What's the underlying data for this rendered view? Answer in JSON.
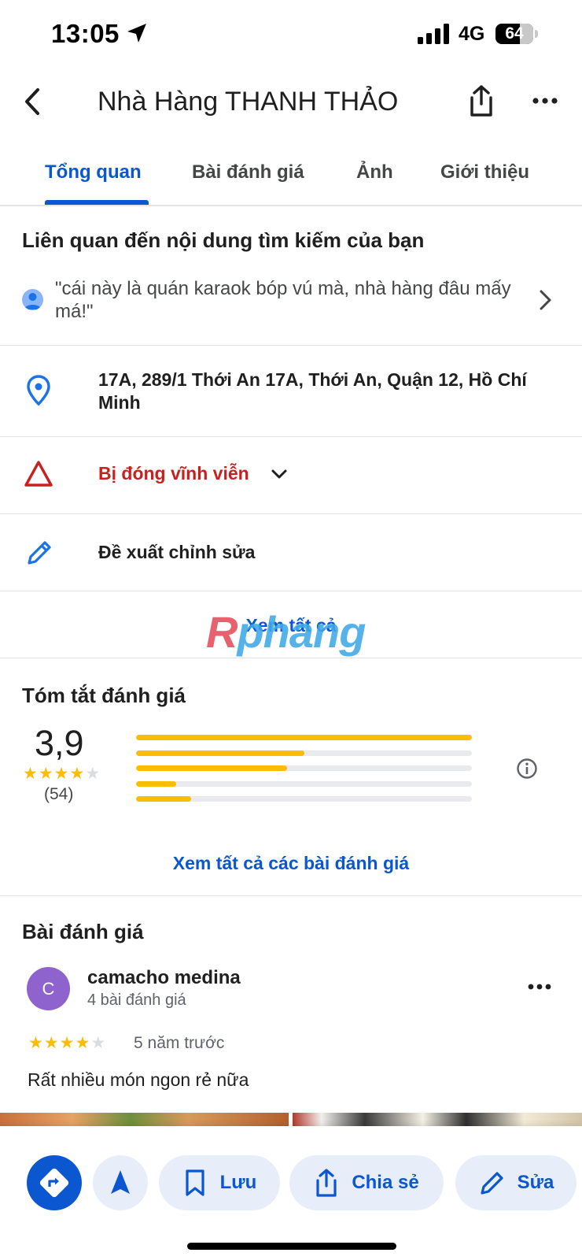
{
  "status": {
    "time": "13:05",
    "network": "4G",
    "battery": "64",
    "battery_level": 0.64
  },
  "header": {
    "title": "Nhà Hàng THANH THẢO",
    "icons": [
      "back-icon",
      "share-icon",
      "more-icon"
    ]
  },
  "tabs": [
    {
      "label": "Tổng quan",
      "active": true
    },
    {
      "label": "Bài đánh giá",
      "active": false
    },
    {
      "label": "Ảnh",
      "active": false
    },
    {
      "label": "Giới thiệu",
      "active": false
    }
  ],
  "related": {
    "title": "Liên quan đến nội dung tìm kiếm của bạn",
    "snippet": "\"cái này là quán karaok bóp vú mà, nhà hàng đâu mấy má!\""
  },
  "info": {
    "address": "17A, 289/1 Thới An 17A, Thới An, Quận 12, Hồ Chí Minh",
    "closed": "Bị đóng vĩnh viễn",
    "suggest_edit": "Đề xuất chỉnh sửa",
    "see_all": "Xem tất cả"
  },
  "watermark": {
    "r": "R",
    "rest": "phang"
  },
  "rating_summary": {
    "title": "Tóm tắt đánh giá",
    "average": "3,9",
    "stars": 4,
    "count": "(54)",
    "distribution": [
      {
        "stars": 5,
        "fraction": 1.0
      },
      {
        "stars": 4,
        "fraction": 0.5
      },
      {
        "stars": 3,
        "fraction": 0.45
      },
      {
        "stars": 2,
        "fraction": 0.12
      },
      {
        "stars": 1,
        "fraction": 0.165
      }
    ],
    "see_all_reviews": "Xem tất cả các bài đánh giá"
  },
  "reviews": {
    "title": "Bài đánh giá",
    "items": [
      {
        "initial": "C",
        "name": "camacho medina",
        "meta": "4 bài đánh giá",
        "stars": 4,
        "time": "5 năm trước",
        "text": "Rất nhiều món ngon rẻ nữa",
        "avatar_color": "#8e63ce"
      }
    ]
  },
  "actions": {
    "save": "Lưu",
    "share": "Chia sẻ",
    "edit": "Sửa"
  },
  "colors": {
    "accent": "#0b57d0",
    "star": "#fbbc04",
    "danger": "#c5221f",
    "pill_bg": "#e8eef9"
  }
}
